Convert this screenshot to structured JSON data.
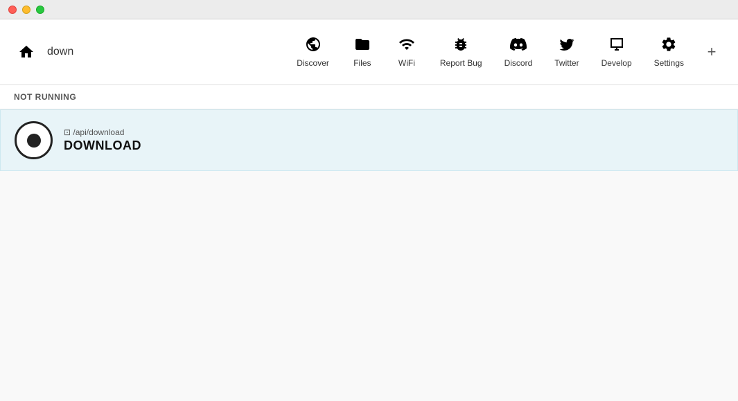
{
  "titlebar": {
    "buttons": [
      "close",
      "minimize",
      "maximize"
    ]
  },
  "navbar": {
    "server_name": "down",
    "nav_items": [
      {
        "id": "discover",
        "label": "Discover",
        "icon": "globe"
      },
      {
        "id": "files",
        "label": "Files",
        "icon": "folder"
      },
      {
        "id": "wifi",
        "label": "WiFi",
        "icon": "wifi"
      },
      {
        "id": "report-bug",
        "label": "Report Bug",
        "icon": "bug"
      },
      {
        "id": "discord",
        "label": "Discord",
        "icon": "discord"
      },
      {
        "id": "twitter",
        "label": "Twitter",
        "icon": "twitter"
      },
      {
        "id": "develop",
        "label": "Develop",
        "icon": "develop"
      },
      {
        "id": "settings",
        "label": "Settings",
        "icon": "gear"
      }
    ],
    "add_label": "+"
  },
  "status": {
    "text": "NOT RUNNING"
  },
  "download_item": {
    "path": "⊡ /api/download",
    "title": "DOWNLOAD"
  }
}
